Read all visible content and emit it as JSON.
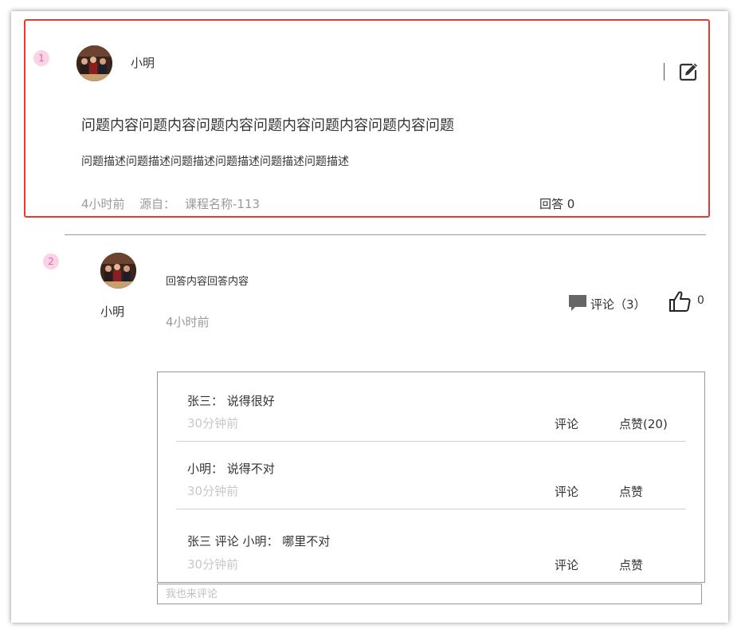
{
  "question": {
    "index": "1",
    "author": "小明",
    "title": "问题内容问题内容问题内容问题内容问题内容问题内容问题",
    "description": "问题描述问题描述问题描述问题描述问题描述问题描述",
    "time": "4小时前",
    "source_label": "源自：",
    "source_value": "课程名称-113",
    "answers_label": "回答 0"
  },
  "answer": {
    "index": "2",
    "author": "小明",
    "content": "回答内容回答内容",
    "time": "4小时前",
    "comment_label": "评论（3）",
    "like_count": "0"
  },
  "comments": [
    {
      "text": "张三：  说得很好",
      "time": "30分钟前",
      "reply_label": "评论",
      "like_label": "点赞(20)"
    },
    {
      "text": "小明：  说得不对",
      "time": "30分钟前",
      "reply_label": "评论",
      "like_label": "点赞"
    },
    {
      "text": "张三 评论  小明：  哪里不对",
      "time": "30分钟前",
      "reply_label": "评论",
      "like_label": "点赞"
    }
  ],
  "comment_input": {
    "placeholder": "我也来评论"
  },
  "colors": {
    "highlight_border": "#e53935",
    "badge_bg": "#fbd3e6",
    "badge_text": "#d86aa0"
  },
  "icons": {
    "edit": "edit-icon",
    "comment": "comment-bubble-icon",
    "like": "thumbs-up-icon"
  }
}
